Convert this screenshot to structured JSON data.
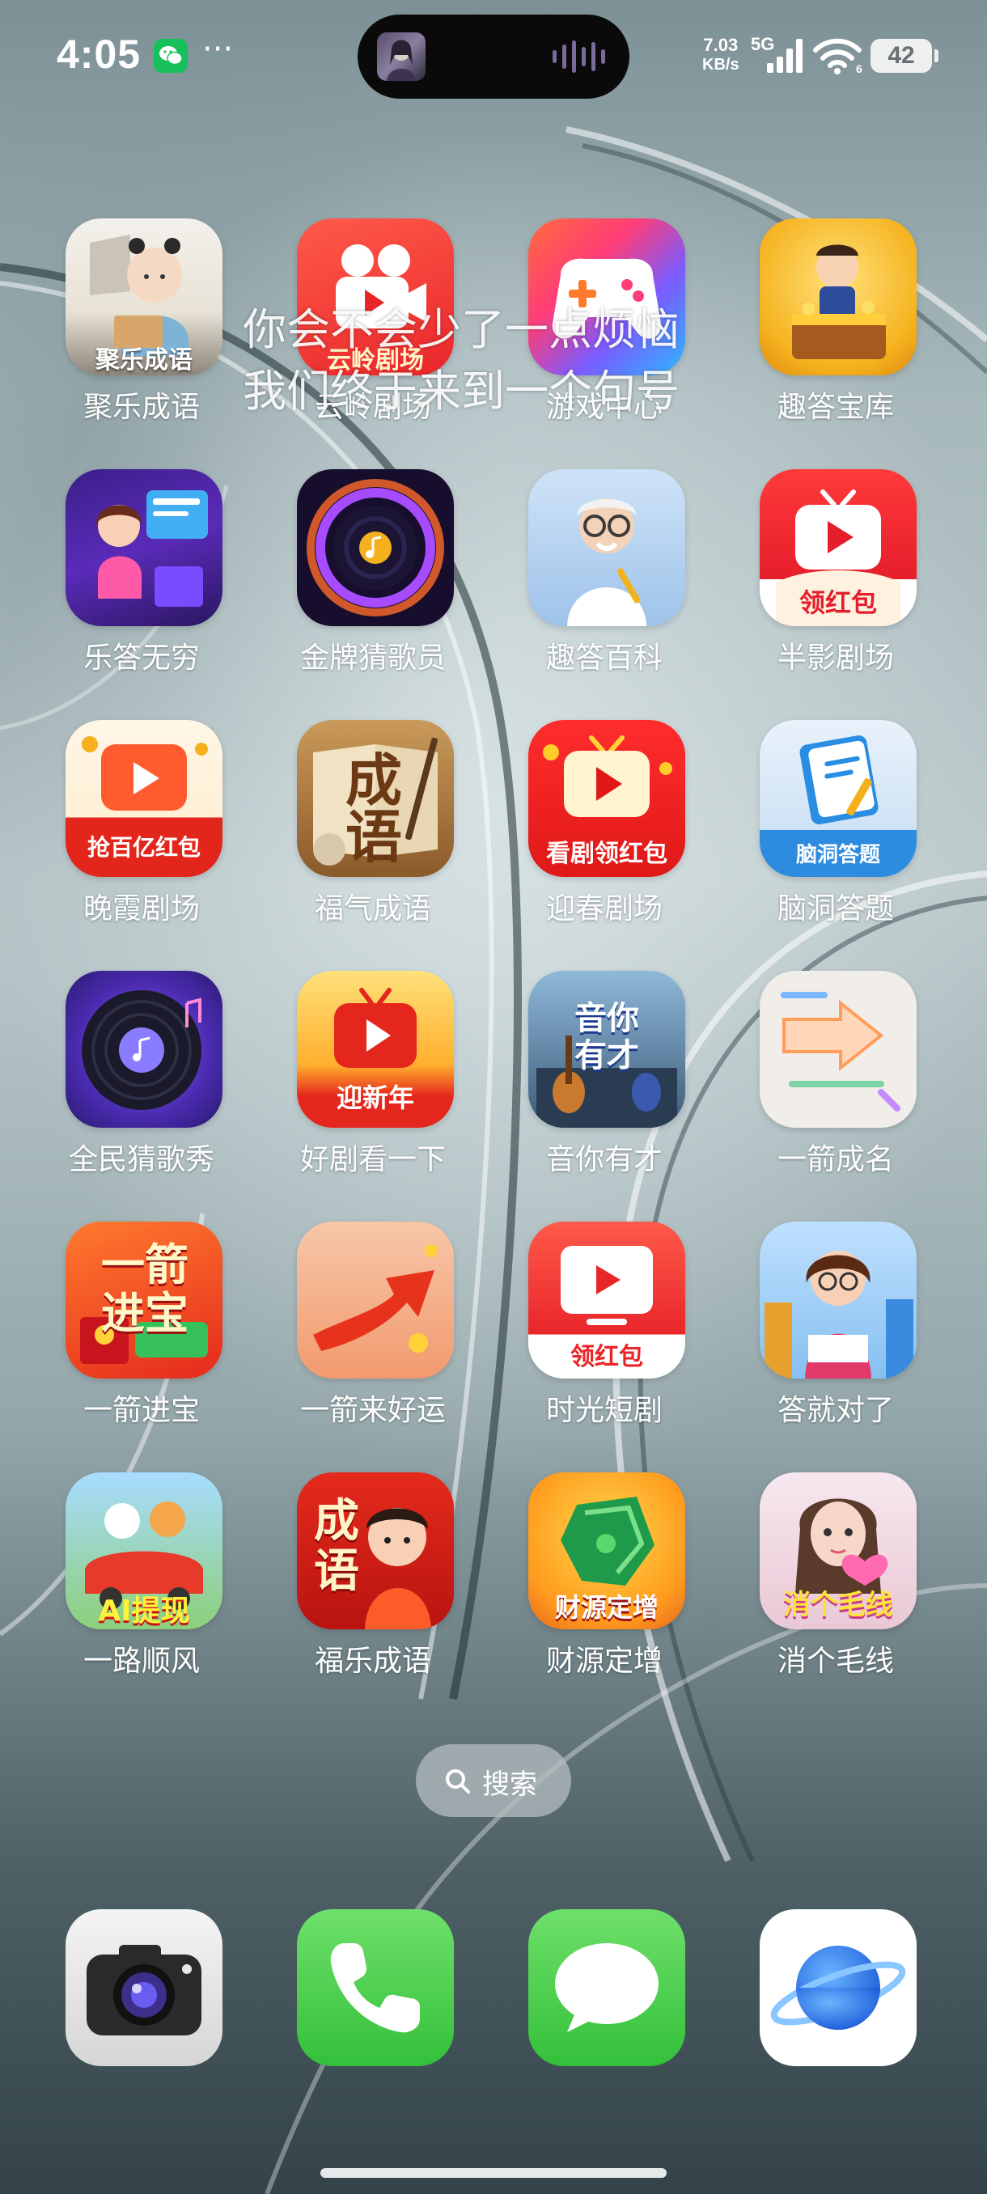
{
  "status_bar": {
    "time": "4:05",
    "more": "···",
    "net_speed_value": "7.03",
    "net_speed_unit": "KB/s",
    "net_type": "5G",
    "wifi_badge": "6",
    "battery": "42"
  },
  "overlay": {
    "line1": "你会不会少了一点烦恼",
    "line2": "我们终于来到一个句号"
  },
  "apps": [
    {
      "label": "聚乐成语",
      "icon": "idiom-boy-icon",
      "badge": "聚乐成语"
    },
    {
      "label": "云岭剧场",
      "icon": "video-camera-icon",
      "badge": "云岭剧场"
    },
    {
      "label": "游戏中心",
      "icon": "gamepad-icon"
    },
    {
      "label": "趣答宝库",
      "icon": "treasure-chest-icon"
    },
    {
      "label": "乐答无穷",
      "icon": "quiz-girl-icon"
    },
    {
      "label": "金牌猜歌员",
      "icon": "music-disc-icon"
    },
    {
      "label": "趣答百科",
      "icon": "professor-icon"
    },
    {
      "label": "半影剧场",
      "icon": "tv-play-icon",
      "badge": "领红包"
    },
    {
      "label": "晚霞剧场",
      "icon": "tv-play-icon",
      "badge": "抢百亿红包"
    },
    {
      "label": "福气成语",
      "icon": "chinese-book-icon",
      "badge": "成语"
    },
    {
      "label": "迎春剧场",
      "icon": "tv-play-icon",
      "badge": "看剧领红包"
    },
    {
      "label": "脑洞答题",
      "icon": "notebook-icon",
      "badge": "脑洞答题"
    },
    {
      "label": "全民猜歌秀",
      "icon": "vinyl-record-icon"
    },
    {
      "label": "好剧看一下",
      "icon": "tv-play-icon",
      "badge": "迎新年"
    },
    {
      "label": "音你有才",
      "icon": "guitar-studio-icon",
      "badge": "音你有才"
    },
    {
      "label": "一箭成名",
      "icon": "arrow-maze-icon"
    },
    {
      "label": "一箭进宝",
      "icon": "red-envelope-icon",
      "badge": "一箭进宝"
    },
    {
      "label": "一箭来好运",
      "icon": "red-arrow-icon"
    },
    {
      "label": "时光短剧",
      "icon": "monitor-play-icon",
      "badge": "领红包"
    },
    {
      "label": "答就对了",
      "icon": "reading-girl-icon"
    },
    {
      "label": "一路顺风",
      "icon": "cartoon-car-icon",
      "badge": "AI提现"
    },
    {
      "label": "福乐成语",
      "icon": "festive-boy-icon",
      "badge": "成语"
    },
    {
      "label": "财源定增",
      "icon": "jade-rock-icon",
      "badge": "财源定增"
    },
    {
      "label": "消个毛线",
      "icon": "yarn-girl-icon",
      "badge": "消个毛线"
    }
  ],
  "search": {
    "label": "搜索"
  },
  "dock": [
    {
      "name": "camera-app",
      "icon": "camera-icon"
    },
    {
      "name": "phone-app",
      "icon": "phone-icon"
    },
    {
      "name": "messages-app",
      "icon": "messages-icon"
    },
    {
      "name": "browser-app",
      "icon": "planet-icon"
    }
  ]
}
